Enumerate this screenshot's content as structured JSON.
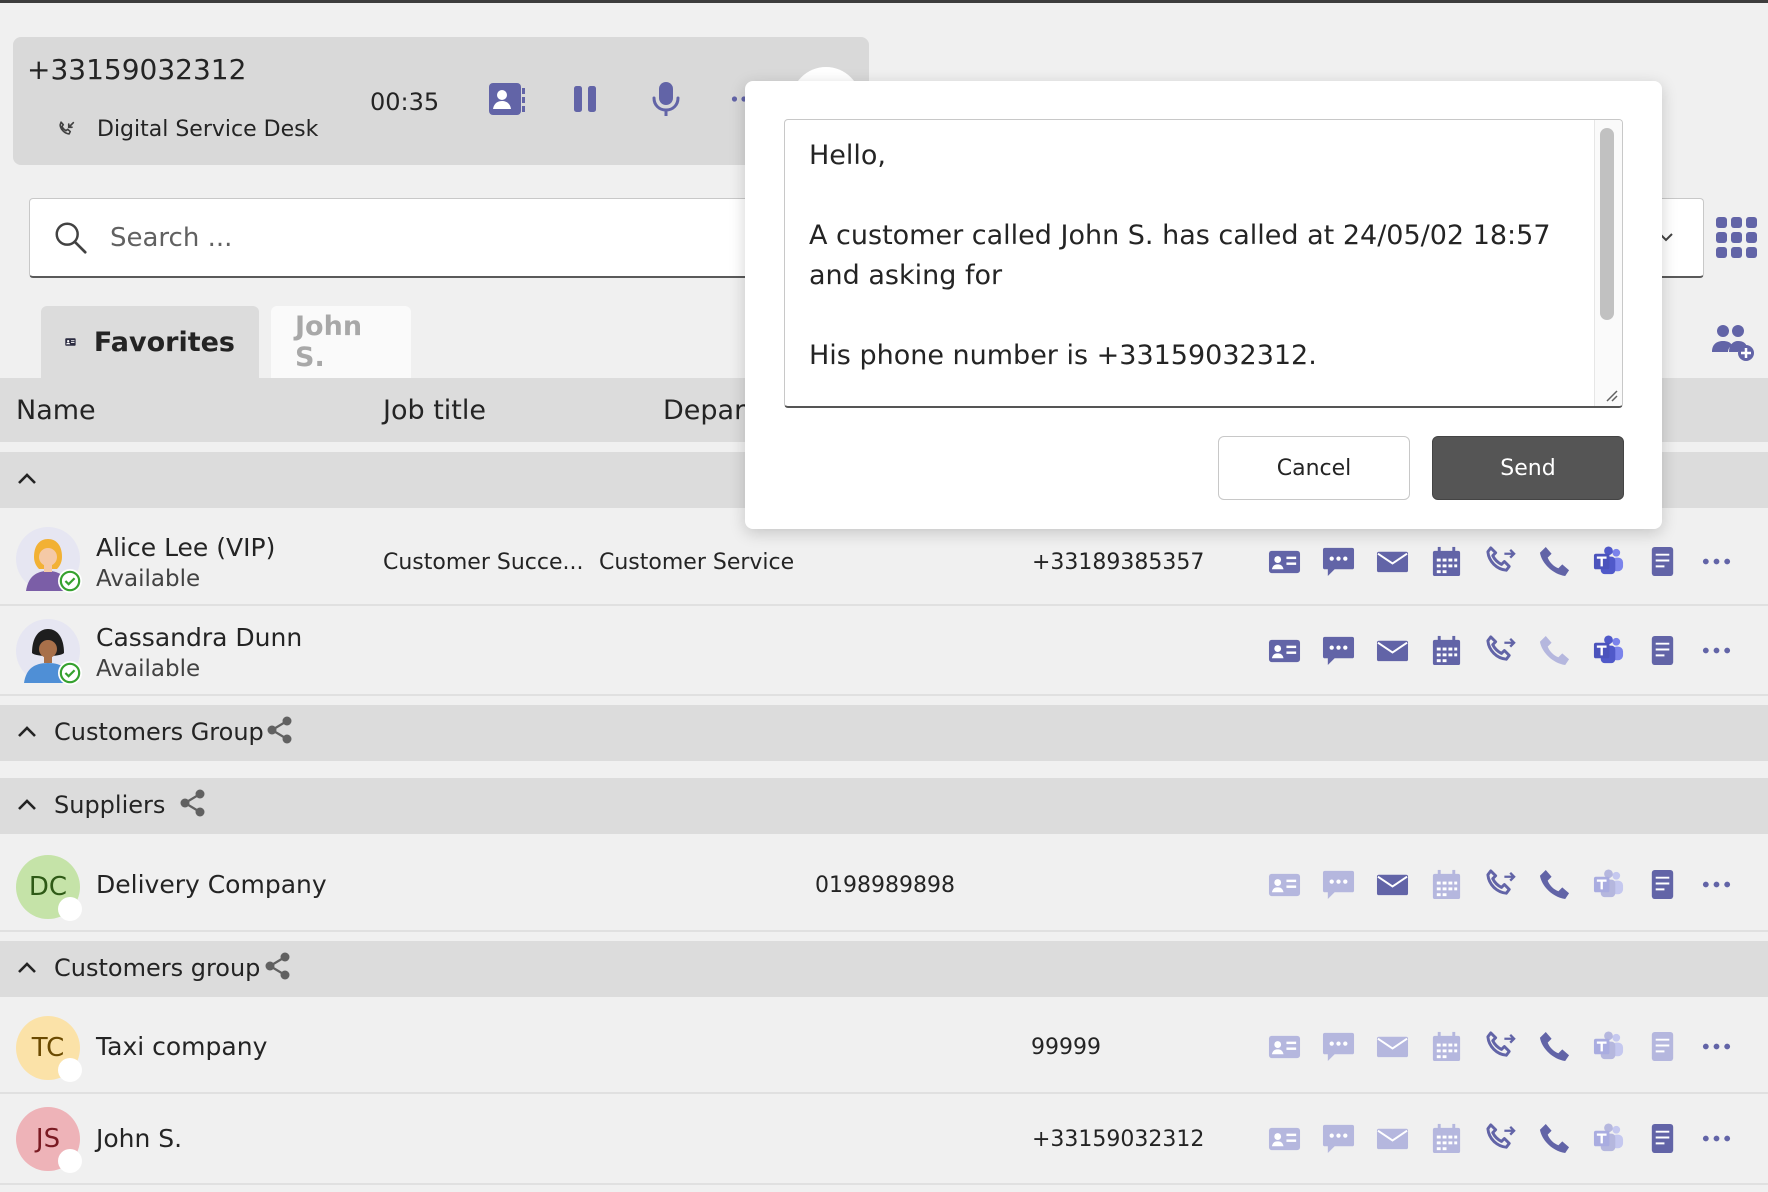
{
  "colors": {
    "accent": "#6264a7",
    "accent_light": "#b5b7de",
    "available": "#36a12f",
    "bg": "#f0f0f0",
    "band": "#dcdcdc"
  },
  "call": {
    "number": "+33159032312",
    "line_name": "Digital Service Desk",
    "timer": "00:35",
    "icons": [
      "contact-card-icon",
      "pause-icon",
      "microphone-icon",
      "more-icon"
    ]
  },
  "search": {
    "placeholder": "Search ..."
  },
  "tabs": [
    {
      "label": "Favorites",
      "icon": "contact-card-icon",
      "active": true
    },
    {
      "label": "John S.",
      "active": false
    }
  ],
  "columns": {
    "name": "Name",
    "job_title": "Job title",
    "department": "Depart"
  },
  "groups": {
    "favorites_label": "",
    "customers_group": "Customers Group",
    "suppliers": "Suppliers",
    "customers_group2": "Customers group"
  },
  "contacts": [
    {
      "name": "Alice Lee (VIP)",
      "status": "Available",
      "job": "Customer Succe...",
      "dept": "Customer Service",
      "phone": "+33189385357"
    },
    {
      "name": "Cassandra Dunn",
      "status": "Available",
      "job": "",
      "dept": "",
      "phone": ""
    },
    {
      "name": "Delivery Company",
      "initials": "DC",
      "phone": "0198989898"
    },
    {
      "name": "Taxi company",
      "initials": "TC",
      "phone": "99999"
    },
    {
      "name": "John S.",
      "initials": "JS",
      "phone": "+33159032312"
    }
  ],
  "modal": {
    "message": "Hello,\n\nA customer called John S. has called at 24/05/02 18:57 and asking for\n\nHis phone number is +33159032312.",
    "cancel_label": "Cancel",
    "send_label": "Send"
  }
}
